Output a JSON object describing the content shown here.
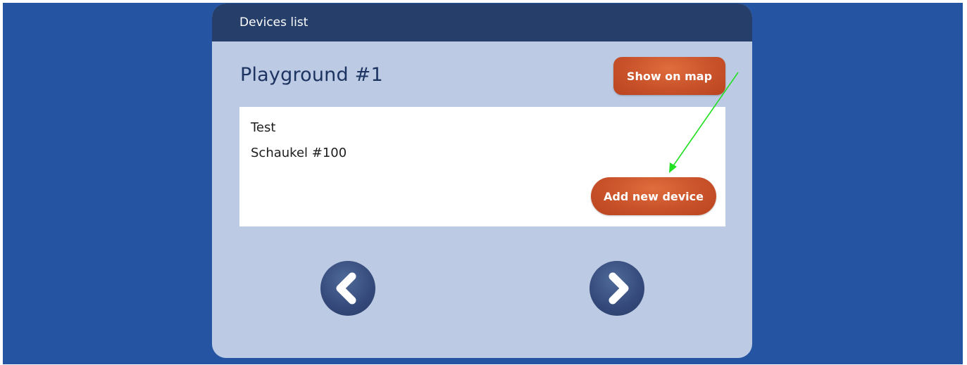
{
  "panel": {
    "header_title": "Devices list",
    "playground_title": "Playground #1",
    "show_on_map_label": "Show on map"
  },
  "devices": {
    "items": [
      "Test",
      "Schaukel #100"
    ],
    "add_label": "Add new device"
  },
  "pagination": {
    "prev_icon": "chevron-left-icon",
    "next_icon": "chevron-right-icon"
  },
  "colors": {
    "page_background": "#2554a2",
    "card_background": "#bccbe3",
    "header_background": "#253e6a",
    "accent_button": "#c9522a",
    "nav_button": "#34497a",
    "annotation_arrow": "#22e022"
  }
}
